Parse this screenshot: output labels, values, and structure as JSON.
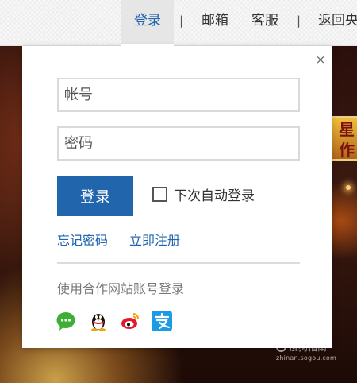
{
  "nav": {
    "login": "登录",
    "separator": "|",
    "mail": "邮箱",
    "service": "客服",
    "back": "返回央"
  },
  "banner": {
    "text": "星作"
  },
  "popup": {
    "close": "×",
    "account_placeholder": "帐号",
    "password_placeholder": "密码",
    "login_button": "登录",
    "remember_label": "下次自动登录",
    "remember_checked": false,
    "forgot_link": "忘记密码",
    "register_link": "立即注册",
    "partner_title": "使用合作网站账号登录",
    "partners": [
      {
        "name": "wechat",
        "icon": "wechat-icon",
        "color": "#3cb034"
      },
      {
        "name": "qq",
        "icon": "qq-penguin-icon",
        "color": "#111111"
      },
      {
        "name": "weibo",
        "icon": "weibo-icon",
        "color": "#e6162d"
      },
      {
        "name": "alipay",
        "icon": "alipay-icon",
        "color": "#1b9be6"
      }
    ]
  },
  "watermark": {
    "main": "搜狗指南",
    "sub": "zhinan.sogou.com"
  },
  "colors": {
    "accent": "#2165ad",
    "divider": "#dcdcdc"
  }
}
